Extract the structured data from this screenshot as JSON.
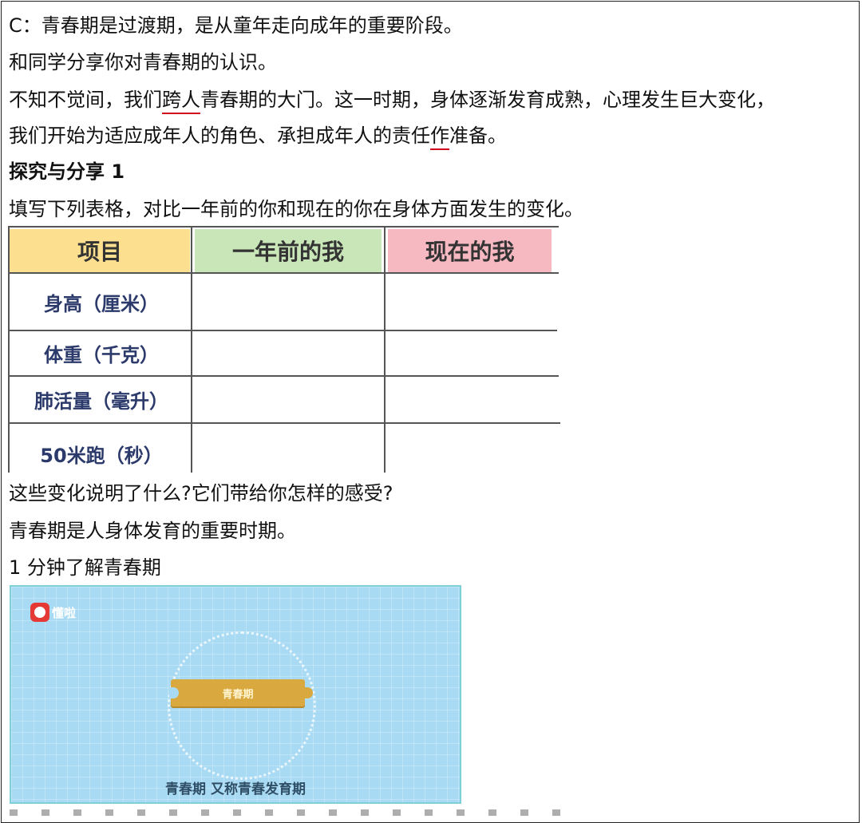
{
  "lines": {
    "l1": "C：青春期是过渡期，是从童年走向成年的重要阶段。",
    "l2": "和同学分享你对青春期的认识。",
    "l3_pre": "不知不觉间，我们",
    "l3_mark": "跨人",
    "l3_post": "青春期的大门。这一时期，身体逐渐发育成熟，心理发生巨大变化，",
    "l4_pre": "我们开始为适应成年人的角色、承担成年人的责任",
    "l4_mark": "作",
    "l4_post": "准备。",
    "l5": "探究与分享 1",
    "l6": "填写下列表格，对比一年前的你和现在的你在身体方面发生的变化。",
    "l7": "这些变化说明了什么?它们带给你怎样的感受?",
    "l8": "青春期是人身体发育的重要时期。",
    "l9": "1 分钟了解青春期"
  },
  "table": {
    "headers": [
      "项目",
      "一年前的我",
      "现在的我"
    ],
    "header_colors": [
      "#fde08f",
      "#c9e6b8",
      "#f6b8c1"
    ],
    "rows": [
      "身高（厘米）",
      "体重（千克）",
      "肺活量（毫升）",
      "50米跑（秒）"
    ]
  },
  "video": {
    "logo_text": "懂啦",
    "puzzle_text": "青春期",
    "subtitle": "青春期  又称青春发育期"
  }
}
